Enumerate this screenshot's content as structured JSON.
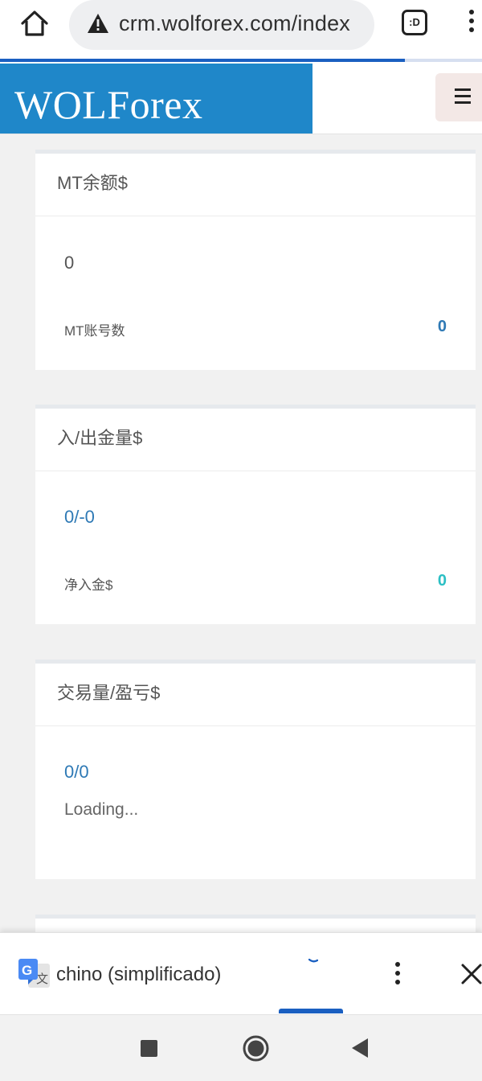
{
  "browser": {
    "url": "crm.wolforex.com/index",
    "tab_switcher_label": ":D",
    "load_progress_percent": 84
  },
  "site": {
    "logo_text": "WOLForex",
    "brand_color": "#1f87c9"
  },
  "cards": {
    "mt_balance": {
      "title": "MT余额$",
      "value": "0",
      "label": "MT账号数",
      "label_value": "0"
    },
    "deposit": {
      "title": "入/出金量$",
      "value": "0/-0",
      "label": "净入金$",
      "label_value": "0"
    },
    "trading": {
      "title": "交易量/盈亏$",
      "value": "0/0",
      "status": "Loading..."
    }
  },
  "colors": {
    "value_blue": "#2e79b5",
    "value_teal": "#2bbfc4",
    "accent_blue": "#1a5fc1"
  },
  "translate_bar": {
    "language_label": "chino (simplificado)"
  },
  "icons": [
    "home-icon",
    "warning-icon",
    "tab-switcher-icon",
    "more-vert-icon",
    "menu-icon",
    "google-translate-icon",
    "close-icon",
    "recent-apps-icon",
    "android-home-icon",
    "back-icon"
  ]
}
